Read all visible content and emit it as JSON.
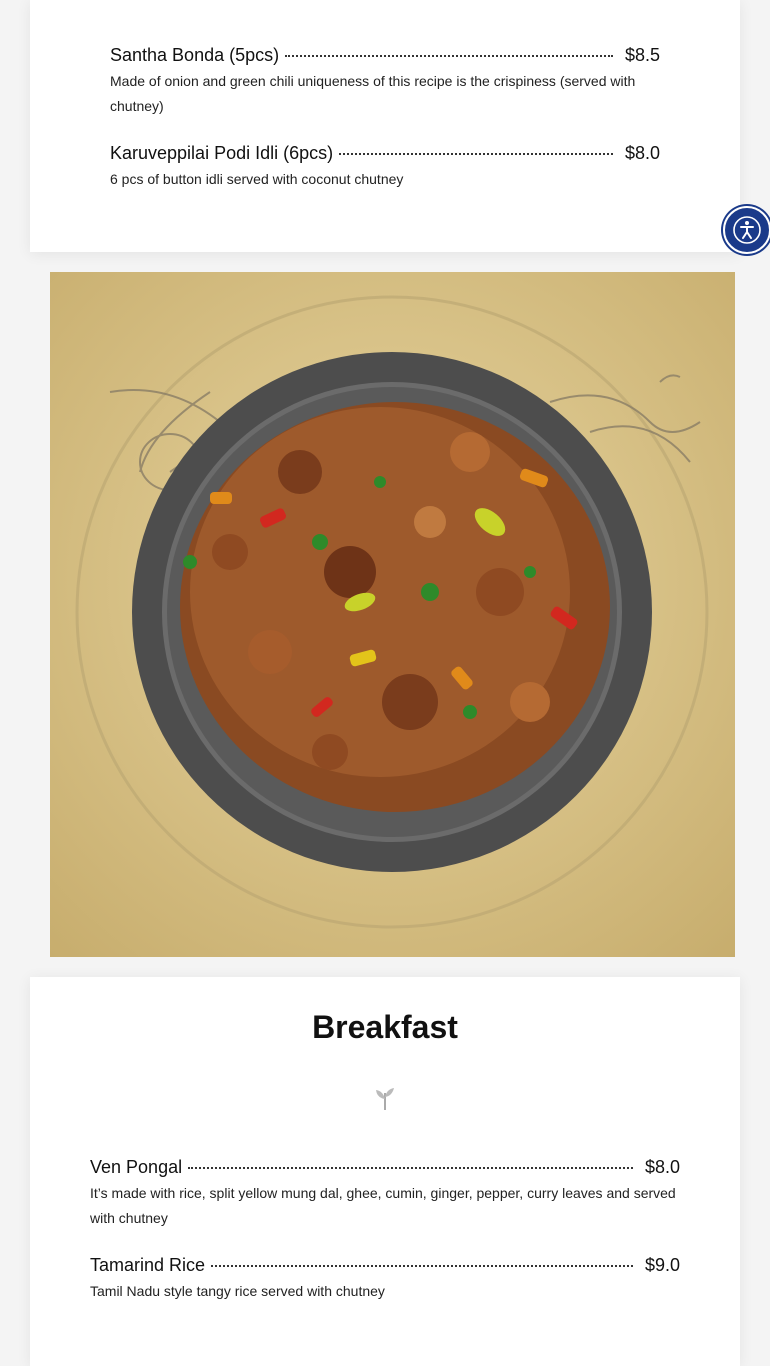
{
  "top_section": {
    "items": [
      {
        "name": "Santha Bonda (5pcs)",
        "price": "$8.5",
        "description": "Made of onion and green chili uniqueness of this recipe is the crispiness (served with chutney)"
      },
      {
        "name": "Karuveppilai Podi Idli (6pcs)",
        "price": "$8.0",
        "description": "6 pcs of button idli served with coconut chutney"
      }
    ]
  },
  "breakfast": {
    "title": "Breakfast",
    "items": [
      {
        "name": "Ven Pongal",
        "price": "$8.0",
        "description": "It’s made with rice, split yellow mung dal, ghee, cumin, ginger, pepper, curry leaves and served with chutney"
      },
      {
        "name": "Tamarind Rice",
        "price": "$9.0",
        "description": "Tamil Nadu style tangy rice served with chutney"
      }
    ]
  },
  "icons": {
    "accessibility": "accessibility-icon",
    "divider": "leaf-icon"
  },
  "colors": {
    "accessibility_button": "#1a3a8a",
    "photo_background": "#d9c389",
    "plate": "#5a5a5a"
  }
}
